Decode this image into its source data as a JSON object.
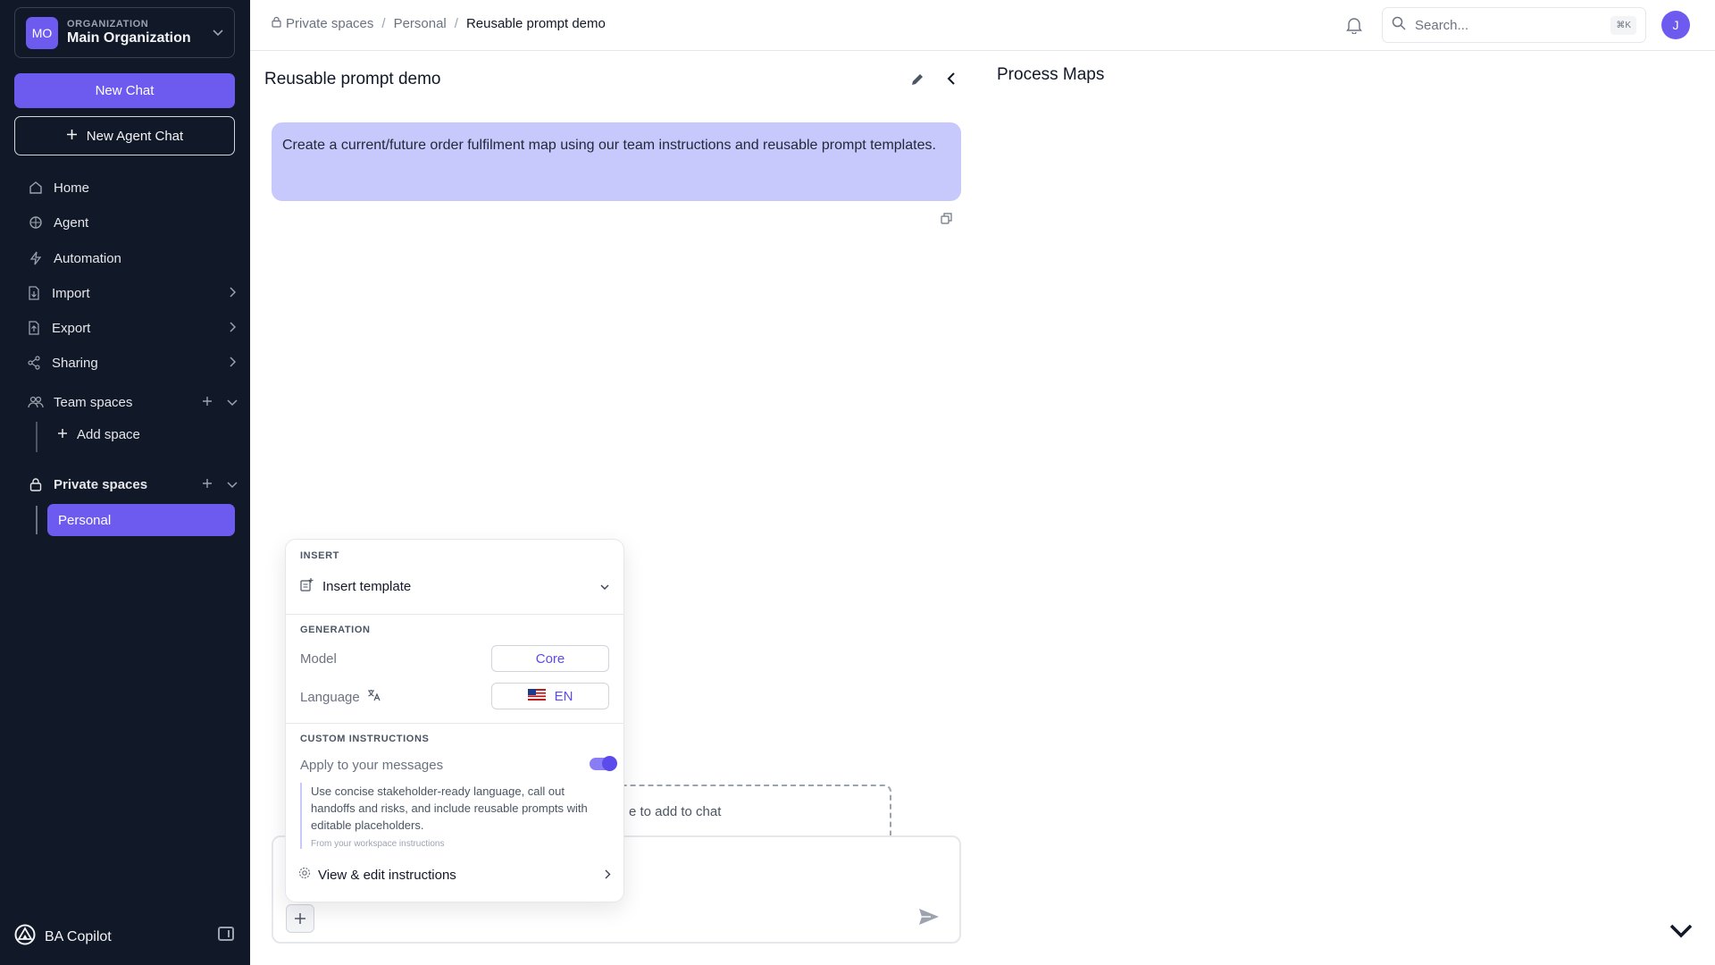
{
  "sidebar": {
    "org": {
      "initials": "MO",
      "label": "ORGANIZATION",
      "name": "Main Organization"
    },
    "new_chat": "New Chat",
    "new_agent_chat": "New Agent Chat",
    "nav": {
      "home": "Home",
      "agent": "Agent",
      "automation": "Automation",
      "import": "Import",
      "export": "Export",
      "sharing": "Sharing"
    },
    "team_spaces": "Team spaces",
    "add_space": "Add space",
    "private_spaces": "Private spaces",
    "personal": "Personal",
    "brand": "BA Copilot"
  },
  "topbar": {
    "breadcrumb": [
      "Private spaces",
      "Personal",
      "Reusable prompt demo"
    ],
    "search_placeholder": "Search...",
    "search_shortcut": "⌘K",
    "user_initial": "J"
  },
  "chat": {
    "title": "Reusable prompt demo",
    "message": "Create a current/future order fulfilment map using our team instructions and reusable prompt templates.",
    "dropzone_text": "e to add to chat"
  },
  "right_panel": {
    "title": "Process Maps"
  },
  "popover": {
    "insert_label": "INSERT",
    "insert_template": "Insert template",
    "generation_label": "GENERATION",
    "model_label": "Model",
    "model_value": "Core",
    "language_label": "Language",
    "language_value": "EN",
    "custom_label": "CUSTOM INSTRUCTIONS",
    "apply_label": "Apply to your messages",
    "apply_enabled": true,
    "instructions_text": "Use concise stakeholder-ready language, call out handoffs and risks, and include reusable prompts with editable placeholders.",
    "instructions_source": "From your workspace instructions",
    "view_edit": "View & edit instructions"
  },
  "colors": {
    "accent": "#6d5bf0",
    "sidebar_bg": "#111827",
    "bubble": "#c7c8fb"
  }
}
